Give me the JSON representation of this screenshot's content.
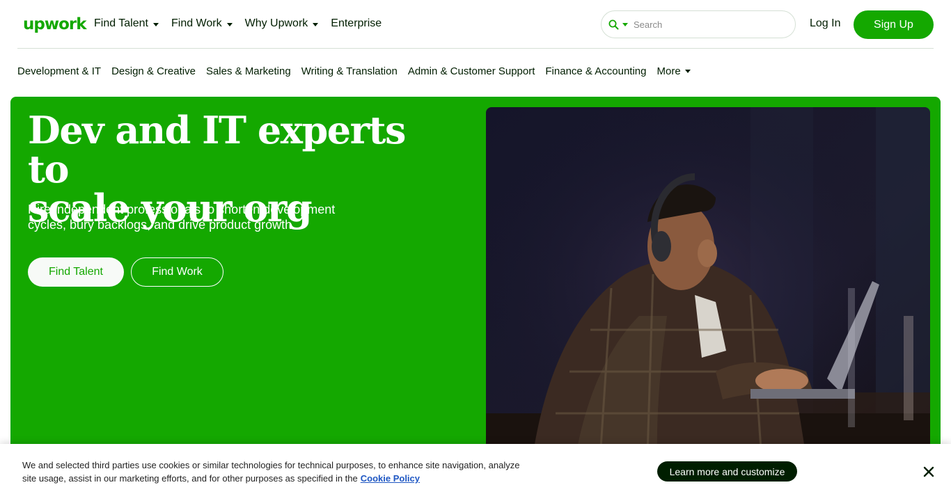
{
  "header": {
    "logo_text": "upwork",
    "nav": [
      {
        "label": "Find Talent",
        "has_dropdown": true
      },
      {
        "label": "Find Work",
        "has_dropdown": true
      },
      {
        "label": "Why Upwork",
        "has_dropdown": true
      },
      {
        "label": "Enterprise",
        "has_dropdown": false
      }
    ],
    "search": {
      "placeholder": "Search",
      "value": ""
    },
    "login_label": "Log In",
    "signup_label": "Sign Up"
  },
  "categories": [
    {
      "label": "Development & IT"
    },
    {
      "label": "Design & Creative"
    },
    {
      "label": "Sales & Marketing"
    },
    {
      "label": "Writing & Translation"
    },
    {
      "label": "Admin & Customer Support"
    },
    {
      "label": "Finance & Accounting"
    },
    {
      "label": "More",
      "has_dropdown": true
    }
  ],
  "hero": {
    "title_line1": "Dev and IT experts to",
    "title_line2": "scale your org",
    "subtitle_line1": "Hire independent professionals to shorten development",
    "subtitle_line2": "cycles, bury backlogs, and drive product growth.",
    "find_talent_label": "Find Talent",
    "find_work_label": "Find Work"
  },
  "cookie_banner": {
    "text_line1": "We and selected third parties use cookies or similar technologies for technical purposes, to enhance site navigation, analyze",
    "text_line2": "site usage, assist in our marketing efforts, and for other purposes as specified in the",
    "policy_link": "Cookie Policy",
    "button_label": "Learn more and customize"
  },
  "colors": {
    "brand_green": "#14a800",
    "text_dark": "#001e00",
    "link_blue": "#1f57c3"
  },
  "icons": [
    "search-icon",
    "chevron-down-icon",
    "close-icon"
  ]
}
